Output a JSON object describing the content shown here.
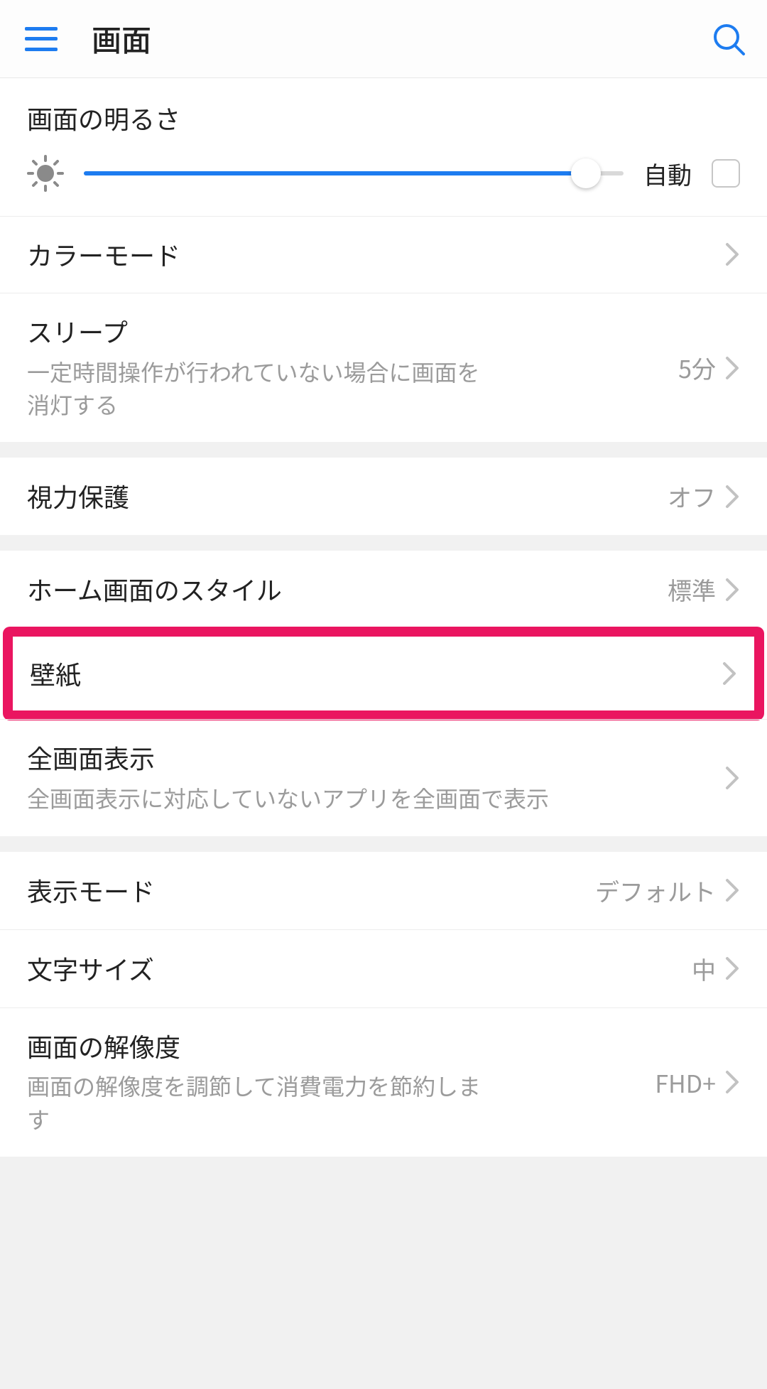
{
  "header": {
    "title": "画面"
  },
  "brightness": {
    "title": "画面の明るさ",
    "auto_label": "自動"
  },
  "rows": {
    "color_mode": {
      "title": "カラーモード"
    },
    "sleep": {
      "title": "スリープ",
      "desc": "一定時間操作が行われていない場合に画面を消灯する",
      "value": "5分"
    },
    "eye_comfort": {
      "title": "視力保護",
      "value": "オフ"
    },
    "home_style": {
      "title": "ホーム画面のスタイル",
      "value": "標準"
    },
    "wallpaper": {
      "title": "壁紙"
    },
    "fullscreen": {
      "title": "全画面表示",
      "desc": "全画面表示に対応していないアプリを全画面で表示"
    },
    "view_mode": {
      "title": "表示モード",
      "value": "デフォルト"
    },
    "text_size": {
      "title": "文字サイズ",
      "value": "中"
    },
    "resolution": {
      "title": "画面の解像度",
      "desc": "画面の解像度を調節して消費電力を節約します",
      "value": "FHD+"
    }
  }
}
